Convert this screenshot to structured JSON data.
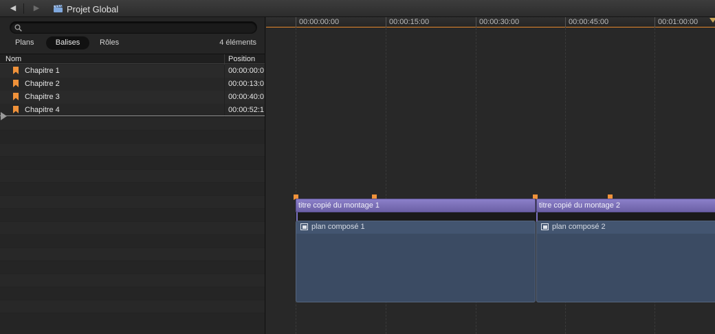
{
  "window": {
    "title": "Projet Global",
    "back_icon": "back-arrow-icon",
    "forward_icon": "forward-arrow-icon",
    "project_icon": "clapperboard-icon"
  },
  "browser": {
    "search": {
      "placeholder": "",
      "value": ""
    },
    "tabs": [
      {
        "label": "Plans",
        "selected": false
      },
      {
        "label": "Balises",
        "selected": true
      },
      {
        "label": "Rôles",
        "selected": false
      }
    ],
    "count": "4 éléments",
    "columns": {
      "name": "Nom",
      "position": "Position"
    },
    "rows": [
      {
        "name": "Chapitre 1",
        "position": "00:00:00:0"
      },
      {
        "name": "Chapitre 2",
        "position": "00:00:13:0"
      },
      {
        "name": "Chapitre 3",
        "position": "00:00:40:0"
      },
      {
        "name": "Chapitre 4",
        "position": "00:00:52:1"
      }
    ],
    "marker_color": "#f0923a"
  },
  "timeline": {
    "ruler_ticks": [
      "00:00:00:00",
      "00:00:15:00",
      "00:00:30:00",
      "00:00:45:00",
      "00:01:00:00"
    ],
    "title_clips": [
      {
        "label": "titre copié du montage 1",
        "color": "#7e73bd"
      },
      {
        "label": "titre copié du montage 2",
        "color": "#7e73bd"
      }
    ],
    "clips": [
      {
        "label": "plan composé 1",
        "icon": "compound-clip-icon",
        "color": "#3b4b63"
      },
      {
        "label": "plan composé 2",
        "icon": "compound-clip-icon",
        "color": "#3b4b63"
      }
    ]
  }
}
